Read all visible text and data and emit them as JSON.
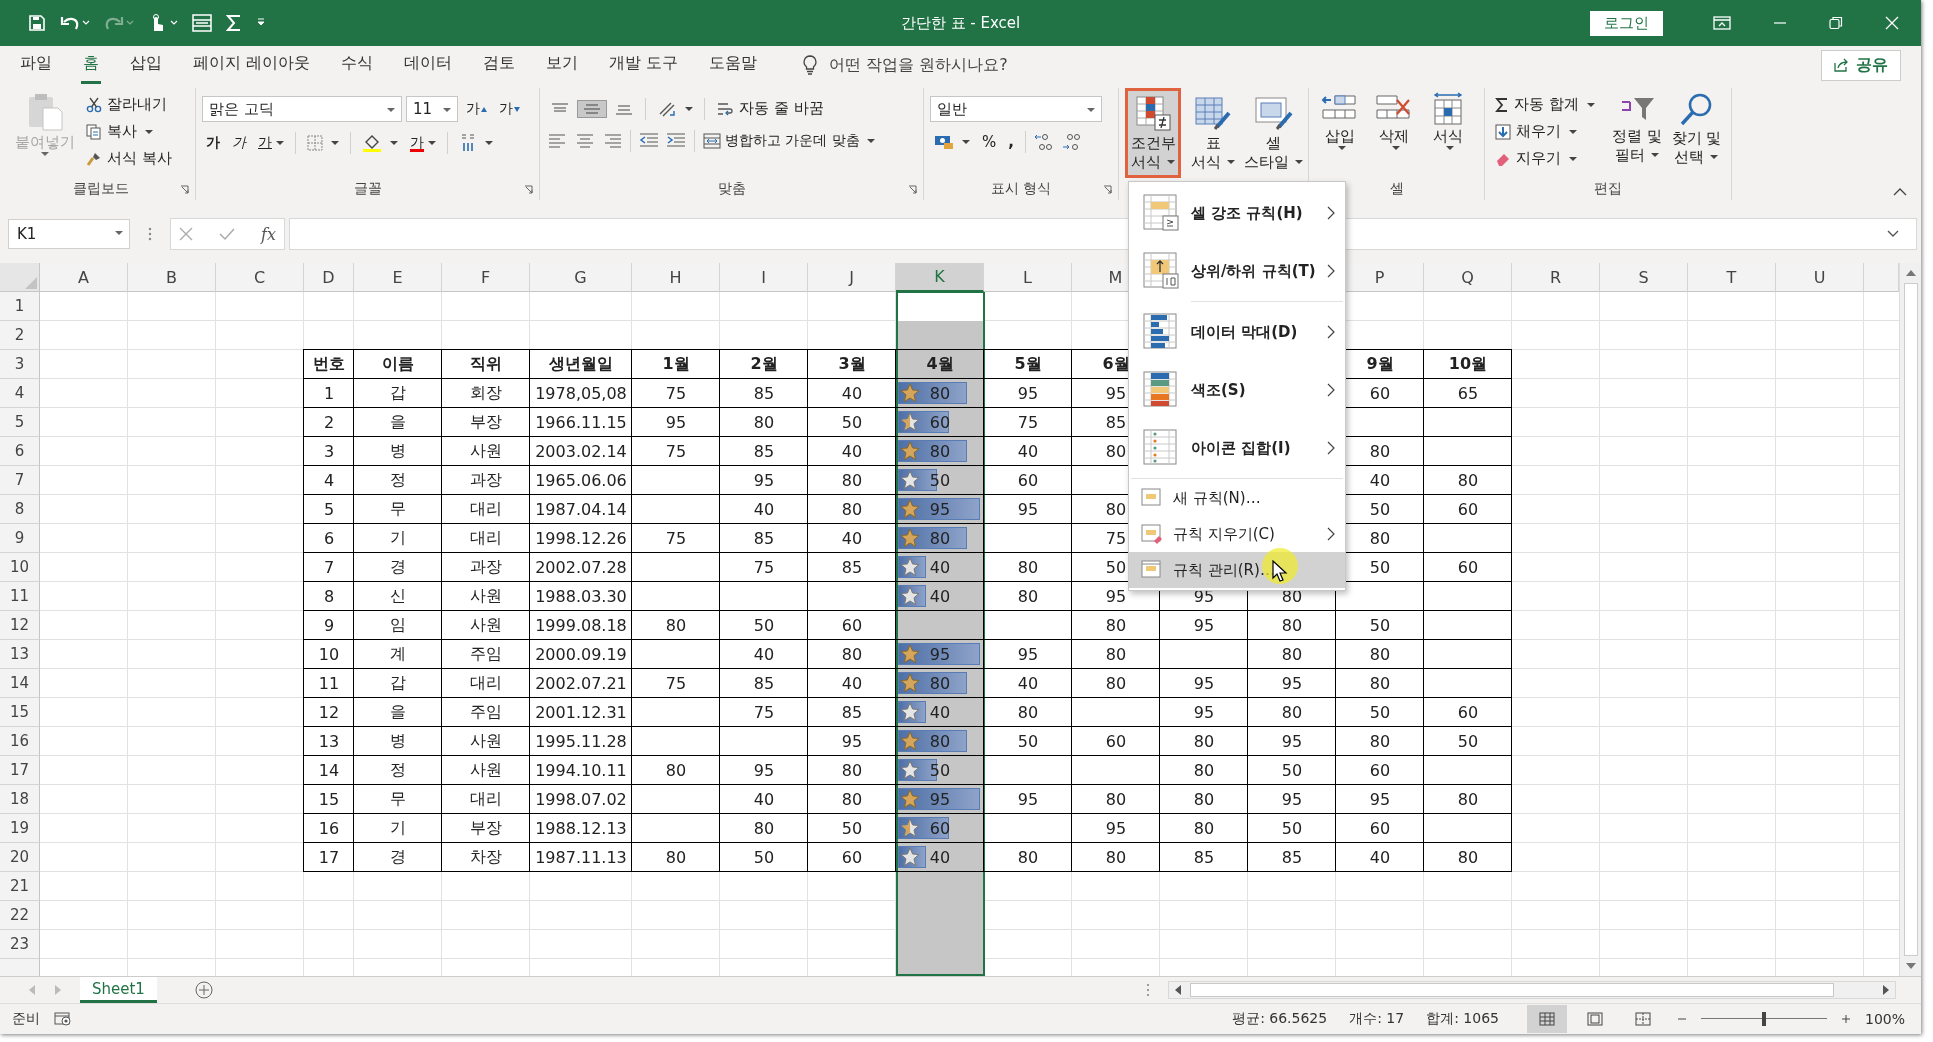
{
  "window": {
    "title": "간단한 표  -  Excel",
    "login_button": "로그인"
  },
  "menu_tabs": [
    {
      "label": "파일",
      "selected": false
    },
    {
      "label": "홈",
      "selected": true
    },
    {
      "label": "삽입",
      "selected": false
    },
    {
      "label": "페이지 레이아웃",
      "selected": false
    },
    {
      "label": "수식",
      "selected": false
    },
    {
      "label": "데이터",
      "selected": false
    },
    {
      "label": "검토",
      "selected": false
    },
    {
      "label": "보기",
      "selected": false
    },
    {
      "label": "개발 도구",
      "selected": false
    },
    {
      "label": "도움말",
      "selected": false
    }
  ],
  "tell_me": {
    "placeholder": "어떤 작업을 원하시나요?"
  },
  "share_button": "공유",
  "ribbon": {
    "clipboard": {
      "paste": {
        "label": "붙여넣기",
        "disabled": true
      },
      "cut": "잘라내기",
      "copy": "복사",
      "format_painter": "서식 복사",
      "label": "클립보드"
    },
    "font": {
      "name": "맑은 고딕",
      "size": "11",
      "grow": "가",
      "shrink": "가",
      "bold": "가",
      "italic": "가",
      "underline": "가",
      "font_color": "가",
      "label": "글꼴"
    },
    "alignment": {
      "vertical": [
        {
          "selected": false
        },
        {
          "selected": true
        },
        {
          "selected": false
        }
      ],
      "wrap_text": "자동 줄 바꿈",
      "merge": "병합하고 가운데 맞춤",
      "label": "맞춤"
    },
    "number": {
      "format": "일반",
      "percent": "%",
      "comma": ",",
      "label": "표시 형식"
    },
    "styles": [
      {
        "lines": [
          "조건부",
          "서식"
        ],
        "selected": true,
        "kind": "conditional"
      },
      {
        "lines": [
          "표",
          "서식"
        ],
        "selected": false,
        "kind": "table"
      },
      {
        "lines": [
          "셀",
          "스타일"
        ],
        "selected": false,
        "kind": "cell"
      }
    ],
    "cells": [
      {
        "label": "삽입",
        "kind": "insert"
      },
      {
        "label": "삭제",
        "kind": "delete"
      },
      {
        "label": "서식",
        "kind": "format"
      }
    ],
    "cells_label": "셀",
    "editing": {
      "autosum": "자동 합계",
      "fill": "채우기",
      "clear": "지우기",
      "sort": [
        "정렬 및",
        "필터"
      ],
      "find": [
        "찾기 및",
        "선택"
      ],
      "label": "편집"
    }
  },
  "formula_bar": {
    "name_box": "K1",
    "function_label": "fx"
  },
  "sheet": {
    "columns": [
      {
        "label": "A",
        "selected": false
      },
      {
        "label": "B",
        "selected": false
      },
      {
        "label": "C",
        "selected": false
      },
      {
        "label": "D",
        "selected": false
      },
      {
        "label": "E",
        "selected": false
      },
      {
        "label": "F",
        "selected": false
      },
      {
        "label": "G",
        "selected": false
      },
      {
        "label": "H",
        "selected": false
      },
      {
        "label": "I",
        "selected": false
      },
      {
        "label": "J",
        "selected": false
      },
      {
        "label": "K",
        "selected": true
      },
      {
        "label": "L",
        "selected": false
      },
      {
        "label": "M",
        "selected": false
      },
      null,
      null,
      {
        "label": "P",
        "selected": false
      },
      {
        "label": "Q",
        "selected": false
      },
      {
        "label": "R",
        "selected": false
      },
      {
        "label": "S",
        "selected": false
      },
      {
        "label": "T",
        "selected": false
      },
      {
        "label": "U",
        "selected": false
      }
    ],
    "row_numbers": [
      "1",
      "2",
      "3",
      "4",
      "5",
      "6",
      "7",
      "8",
      "9",
      "10",
      "11",
      "12",
      "13",
      "14",
      "15",
      "16",
      "17",
      "18",
      "19",
      "20",
      "21",
      "22",
      "23"
    ]
  },
  "table": {
    "columns": [
      "번호",
      "이름",
      "직위",
      "생년월일",
      "1월",
      "2월",
      "3월",
      "4월",
      "5월",
      "6월",
      null,
      null,
      "9월",
      "10월"
    ],
    "rows": [
      {
        "cells": [
          "1",
          "갑",
          "회장",
          "1978,05,08",
          "75",
          "85",
          "40",
          {
            "value": "80",
            "level": 0.82,
            "kind": "full_star"
          },
          "95",
          "95",
          null,
          null,
          "60",
          "65"
        ]
      },
      {
        "cells": [
          "2",
          "을",
          "부장",
          "1966.11.15",
          "95",
          "80",
          "50",
          {
            "value": "60",
            "level": 0.61,
            "kind": "half_star"
          },
          "75",
          "85",
          null,
          null,
          null,
          null
        ]
      },
      {
        "cells": [
          "3",
          "병",
          "사원",
          "2003.02.14",
          "75",
          "85",
          "40",
          {
            "value": "80",
            "level": 0.82,
            "kind": "full_star"
          },
          "40",
          "80",
          null,
          null,
          "80",
          null
        ]
      },
      {
        "cells": [
          "4",
          "정",
          "과장",
          "1965.06.06",
          null,
          "95",
          "80",
          {
            "value": "50",
            "level": 0.47,
            "kind": "empty_star"
          },
          "60",
          null,
          null,
          null,
          "40",
          "80"
        ]
      },
      {
        "cells": [
          "5",
          "무",
          "대리",
          "1987.04.14",
          null,
          "40",
          "80",
          {
            "value": "95",
            "level": 0.98,
            "kind": "full_star"
          },
          "95",
          "80",
          null,
          null,
          "50",
          "60"
        ]
      },
      {
        "cells": [
          "6",
          "기",
          "대리",
          "1998.12.26",
          "75",
          "85",
          "40",
          {
            "value": "80",
            "level": 0.82,
            "kind": "full_star"
          },
          null,
          "75",
          null,
          null,
          "80",
          null
        ]
      },
      {
        "cells": [
          "7",
          "경",
          "과장",
          "2002.07.28",
          null,
          "75",
          "85",
          {
            "value": "40",
            "level": 0.33,
            "kind": "empty_star"
          },
          "80",
          "50",
          null,
          null,
          "50",
          "60"
        ]
      },
      {
        "cells": [
          "8",
          "신",
          "사원",
          "1988.03.30",
          null,
          null,
          null,
          {
            "value": "40",
            "level": 0.33,
            "kind": "empty_star"
          },
          "80",
          "95",
          "95",
          "80",
          null,
          null
        ]
      },
      {
        "cells": [
          "9",
          "임",
          "사원",
          "1999.08.18",
          "80",
          "50",
          "60",
          null,
          null,
          "80",
          "95",
          "80",
          "50",
          null
        ]
      },
      {
        "cells": [
          "10",
          "계",
          "주임",
          "2000.09.19",
          null,
          "40",
          "80",
          {
            "value": "95",
            "level": 0.98,
            "kind": "full_star"
          },
          "95",
          "80",
          null,
          "80",
          "80",
          null
        ]
      },
      {
        "cells": [
          "11",
          "갑",
          "대리",
          "2002.07.21",
          "75",
          "85",
          "40",
          {
            "value": "80",
            "level": 0.82,
            "kind": "full_star"
          },
          "40",
          "80",
          "95",
          "95",
          "80",
          null
        ]
      },
      {
        "cells": [
          "12",
          "을",
          "주임",
          "2001.12.31",
          null,
          "75",
          "85",
          {
            "value": "40",
            "level": 0.33,
            "kind": "empty_star"
          },
          "80",
          null,
          "95",
          "80",
          "50",
          "60"
        ]
      },
      {
        "cells": [
          "13",
          "병",
          "사원",
          "1995.11.28",
          null,
          null,
          "95",
          {
            "value": "80",
            "level": 0.82,
            "kind": "full_star"
          },
          "50",
          "60",
          "80",
          "95",
          "80",
          "50"
        ]
      },
      {
        "cells": [
          "14",
          "정",
          "사원",
          "1994.10.11",
          "80",
          "95",
          "80",
          {
            "value": "50",
            "level": 0.47,
            "kind": "empty_star"
          },
          null,
          null,
          "80",
          "50",
          "60",
          null
        ]
      },
      {
        "cells": [
          "15",
          "무",
          "대리",
          "1998.07.02",
          null,
          "40",
          "80",
          {
            "value": "95",
            "level": 0.98,
            "kind": "full_star"
          },
          "95",
          "80",
          "80",
          "95",
          "95",
          "80"
        ]
      },
      {
        "cells": [
          "16",
          "기",
          "부장",
          "1988.12.13",
          null,
          "80",
          "50",
          {
            "value": "60",
            "level": 0.61,
            "kind": "half_star"
          },
          null,
          "95",
          "80",
          "50",
          "60",
          null
        ]
      },
      {
        "cells": [
          "17",
          "경",
          "차장",
          "1987.11.13",
          "80",
          "50",
          "60",
          {
            "value": "40",
            "level": 0.33,
            "kind": "empty_star"
          },
          "80",
          "80",
          "85",
          "85",
          "40",
          "80"
        ]
      }
    ]
  },
  "conditional_menu": {
    "items": [
      {
        "label": "셀 강조 규칙(H)",
        "kind": "highlight",
        "submenu": true,
        "selected": false,
        "divider_before": false
      },
      {
        "label": "상위/하위 규칙(T)",
        "kind": "topbottom",
        "submenu": true,
        "selected": false,
        "divider_before": false
      },
      {
        "label": "데이터 막대(D)",
        "kind": "databar",
        "submenu": true,
        "selected": false,
        "divider_before": true
      },
      {
        "label": "색조(S)",
        "kind": "colorscale",
        "submenu": true,
        "selected": false,
        "divider_before": false
      },
      {
        "label": "아이콘 집합(I)",
        "kind": "iconset",
        "submenu": true,
        "selected": false,
        "divider_before": false
      },
      {
        "label": "새 규칙(N)…",
        "kind": "new",
        "submenu": false,
        "selected": false,
        "divider_before": true
      },
      {
        "label": "규칙 지우기(C)",
        "kind": "clear",
        "submenu": true,
        "selected": false,
        "divider_before": false
      },
      {
        "label": "규칙 관리(R)…",
        "kind": "manage",
        "submenu": false,
        "selected": true,
        "divider_before": false
      }
    ]
  },
  "sheet_tabs": [
    {
      "label": "Sheet1",
      "selected": true
    }
  ],
  "status_bar": {
    "mode": "준비",
    "average": "평균: 66.5625",
    "count": "개수: 17",
    "sum": "합계: 1065",
    "views": [
      {
        "selected": true
      },
      {
        "selected": false
      },
      {
        "selected": false
      }
    ],
    "zoom": {
      "level": 0.5
    },
    "zoom_label": "100%"
  }
}
